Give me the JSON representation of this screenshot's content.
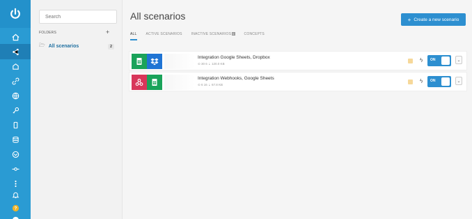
{
  "page": {
    "title": "All scenarios",
    "create_label": "Create a new scenario"
  },
  "search": {
    "placeholder": "Search"
  },
  "folders": {
    "header": "FOLDERS",
    "plus": "+",
    "items": [
      {
        "label": "All scenarios",
        "count": "2"
      }
    ]
  },
  "tabs": [
    {
      "label": "ALL",
      "active": true
    },
    {
      "label": "ACTIVE SCENARIOS",
      "active": false
    },
    {
      "label": "INACTIVE SCENARIOS",
      "badge": "0",
      "active": false
    },
    {
      "label": "CONCEPTS",
      "active": false
    }
  ],
  "scenarios": [
    {
      "name": "Integration Google Sheets, Dropbox",
      "meta": "⊙ 30 6  ⇣ 120.0 KB",
      "toggle": "ON",
      "modules": [
        {
          "icon": "google-sheets-icon",
          "color": "#1aa35a"
        },
        {
          "icon": "dropbox-icon",
          "color": "#1f74d4"
        }
      ]
    },
    {
      "name": "Integration Webhooks, Google Sheets",
      "meta": "⊙ 6 16  ⇣ 67.8 KB",
      "toggle": "ON",
      "modules": [
        {
          "icon": "webhooks-icon",
          "color": "#d8365a"
        },
        {
          "icon": "google-sheets-icon",
          "color": "#1aa35a"
        }
      ]
    }
  ],
  "colors": {
    "rail": "#2a9bd3",
    "accent": "#2d8fd0",
    "warning": "#f6d89a"
  }
}
